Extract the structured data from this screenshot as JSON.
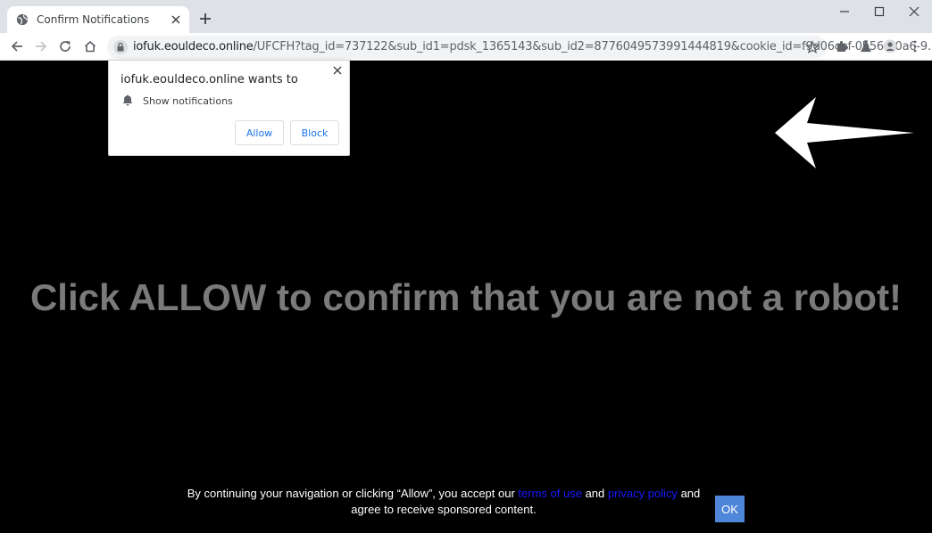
{
  "browser": {
    "tab": {
      "title": "Confirm Notifications"
    },
    "address": {
      "host": "iofuk.eouldeco.online",
      "path": "/UFCFH?tag_id=737122&sub_id1=pdsk_1365143&sub_id2=8776049573991444819&cookie_id=f9d06cef-0b56-40a6-9..."
    }
  },
  "popup": {
    "title": "iofuk.eouldeco.online wants to",
    "permission": "Show notifications",
    "allow_label": "Allow",
    "block_label": "Block"
  },
  "page": {
    "headline": "Click ALLOW to confirm that you are not a robot!",
    "consent": {
      "prefix": "By continuing your navigation or clicking “Allow”, you accept our",
      "terms_link": "terms of use",
      "and": "and",
      "privacy_link": "privacy policy",
      "suffix": "and agree to receive sponsored content."
    },
    "ok_label": "OK"
  },
  "colors": {
    "background": "#000000",
    "headline": "#7a7a7a",
    "link": "#1a1aff",
    "ok_button": "#4e86d9",
    "popup_button_text": "#1a73e8"
  }
}
